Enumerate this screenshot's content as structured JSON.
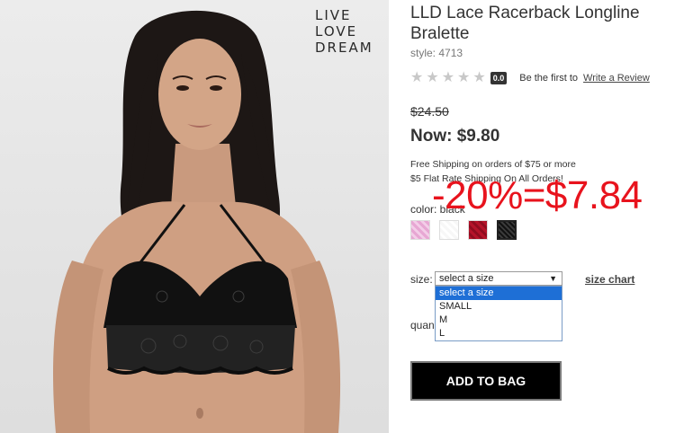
{
  "photo": {
    "brand_lines": [
      "LIVE",
      "LOVE",
      "DREAM"
    ]
  },
  "product": {
    "title": "LLD Lace Racerback Longline Bralette",
    "style": "style: 4713",
    "rating": {
      "stars": [
        "★",
        "★",
        "★",
        "★",
        "★"
      ],
      "score": "0.0",
      "be_first": "Be the first to",
      "write_review": "Write a Review"
    },
    "old_price": "$24.50",
    "now_price": "Now: $9.80",
    "shipping_lines": [
      "Free Shipping on orders of $75 or more",
      "$5 Flat Rate Shipping On All Orders!"
    ],
    "discount_annotation": "-20%=$7.84",
    "color_label": "color: black",
    "swatches": [
      "pink",
      "white",
      "red",
      "black"
    ],
    "selected_swatch": "black",
    "size_label": "size:",
    "size_select_value": "select a size",
    "size_options": [
      "select a size",
      "SMALL",
      "M",
      "L"
    ],
    "size_chart": "size chart",
    "quantity_label": "quan",
    "add_to_bag": "ADD TO BAG"
  },
  "colors": {
    "accent_red": "#e8131d",
    "button_bg": "#000000",
    "dropdown_highlight": "#1e6fd6"
  }
}
